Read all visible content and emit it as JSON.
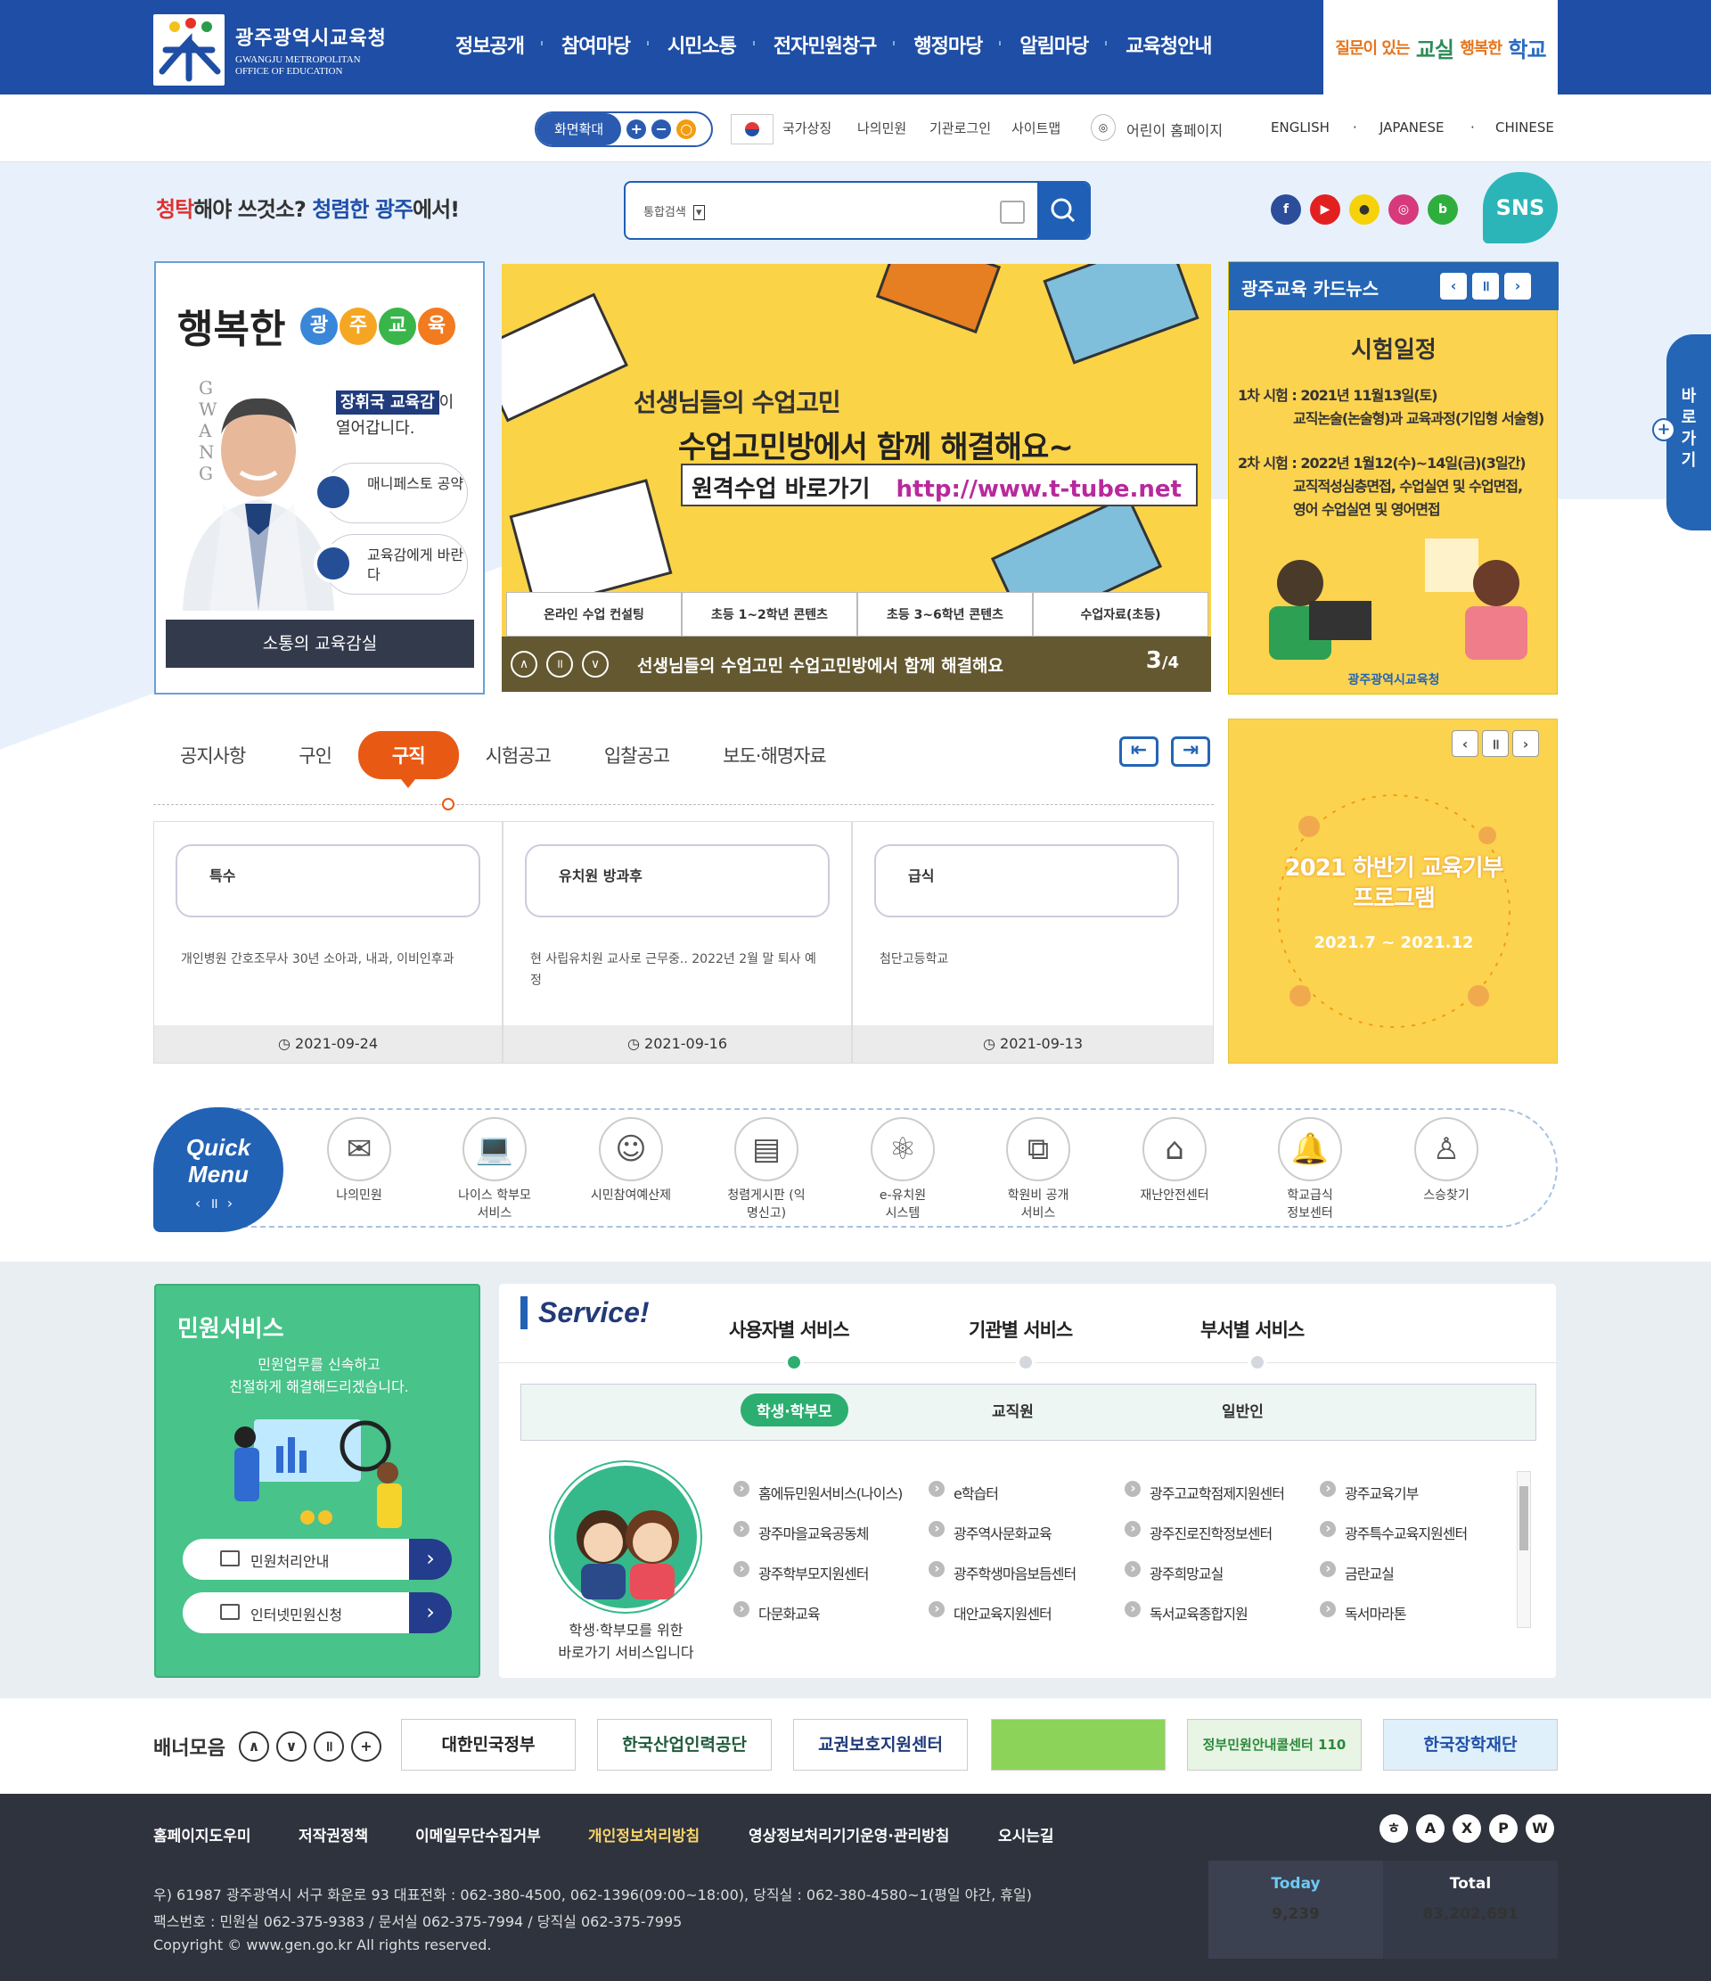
{
  "header": {
    "logo_ko": "광주광역시교육청",
    "logo_en_1": "GWANGJU METROPOLITAN",
    "logo_en_2": "OFFICE OF EDUCATION",
    "nav": [
      "정보공개",
      "참여마당",
      "시민소통",
      "전자민원창구",
      "행정마당",
      "알림마당",
      "교육청안내"
    ],
    "slogan_1": "질문이 있는",
    "slogan_2": "교실",
    "slogan_3": "행복한",
    "slogan_4": "학교"
  },
  "util": {
    "zoom_label": "화면확대",
    "links": [
      "국가상징",
      "나의민원",
      "기관로그인",
      "사이트맵"
    ],
    "kids": "어린이 홈페이지",
    "langs": [
      "ENGLISH",
      "JAPANESE",
      "CHINESE"
    ]
  },
  "campaign": {
    "p1": "청탁",
    "p2": "해야 쓰것소?",
    "p3": "청렴한 광주",
    "p4": "에서!"
  },
  "search": {
    "select": "통합검색"
  },
  "sns_label": "SNS",
  "superintendent": {
    "title_1": "행복한",
    "title_balls": [
      "광",
      "주",
      "교",
      "육"
    ],
    "vertical": "GWANG",
    "name": "장휘국 교육감",
    "name_suffix": "이",
    "name_line2": "열어갑니다.",
    "btn1": "매니페스토 공약",
    "btn2": "교육감에게 바란다",
    "bar": "소통의 교육감실"
  },
  "banner": {
    "h1": "선생님들의 수업고민",
    "h2": "수업고민방에서 함께 해결해요~",
    "link_label": "원격수업 바로가기",
    "link_url": "http://www.t-tube.net",
    "tabs": [
      "온라인 수업 컨설팅",
      "초등 1~2학년 콘텐츠",
      "초등 3~6학년 콘텐츠",
      "수업자료(초등)"
    ],
    "caption": "선생님들의 수업고민 수업고민방에서 함께 해결해요",
    "page": "3",
    "total": "/4"
  },
  "cardnews": {
    "title": "광주교육 카드뉴스",
    "headline": "시험일정",
    "l1": "1차 시험 : 2021년 11월13일(토)",
    "l2": "교직논술(논술형)과 교육과정(기입형 서술형)",
    "l3": "2차 시험 : 2022년 1월12(수)~14일(금)(3일간)",
    "l4": "교직적성심층면접, 수업실연 및 수업면접,",
    "l5": "영어 수업실연 및 영어면접",
    "footer": "광주광역시교육청"
  },
  "side": {
    "label": "바로가기"
  },
  "notice": {
    "tabs": [
      "공지사항",
      "구인",
      "구직",
      "시험공고",
      "입찰공고",
      "보도·해명자료"
    ],
    "active": "구직",
    "cards": [
      {
        "tag": "특수",
        "text": "개인병원 간호조무사 30년 소아과, 내과, 이비인후과",
        "date": "2021-09-24"
      },
      {
        "tag": "유치원 방과후",
        "text": "현 사립유치원 교사로 근무중.. 2022년 2월 말 퇴사 예정",
        "date": "2021-09-16"
      },
      {
        "tag": "급식",
        "text": "첨단고등학교",
        "date": "2021-09-13"
      }
    ]
  },
  "donation": {
    "title": "2021 하반기 교육기부 프로그램",
    "date": "2021.7 ~ 2021.12"
  },
  "quick": {
    "title_1": "Quick",
    "title_2": "Menu",
    "items": [
      {
        "label": "나의민원",
        "icon": "envelope-icon"
      },
      {
        "label": "나이스 학부모 서비스",
        "icon": "laptop-icon"
      },
      {
        "label": "시민참여예산제",
        "icon": "person-speech-icon"
      },
      {
        "label": "청렴게시판 (익명신고)",
        "icon": "notebook-icon"
      },
      {
        "label": "e-유치원 시스템",
        "icon": "atom-icon"
      },
      {
        "label": "학원비 공개 서비스",
        "icon": "puzzle-icon"
      },
      {
        "label": "재난안전센터",
        "icon": "house-icon"
      },
      {
        "label": "학교급식 정보센터",
        "icon": "bell-icon"
      },
      {
        "label": "스승찾기",
        "icon": "teacher-icon"
      }
    ]
  },
  "minwon": {
    "title": "민원서비스",
    "desc_1": "민원업무를 신속하고",
    "desc_2": "친절하게 해결해드리겠습니다.",
    "btn1": "민원처리안내",
    "btn2": "인터넷민원신청"
  },
  "service": {
    "logo": "Service!",
    "tabs": [
      "사용자별 서비스",
      "기관별 서비스",
      "부서별 서비스"
    ],
    "sub": [
      "학생·학부모",
      "교직원",
      "일반인"
    ],
    "desc_1": "학생·학부모를 위한",
    "desc_2": "바로가기 서비스입니다",
    "items": [
      "홈에듀민원서비스(나이스)",
      "e학습터",
      "광주고교학점제지원센터",
      "광주교육기부",
      "광주마을교육공동체",
      "광주역사문화교육",
      "광주진로진학정보센터",
      "광주특수교육지원센터",
      "광주학부모지원센터",
      "광주학생마음보듬센터",
      "광주희망교실",
      "금란교실",
      "다문화교육",
      "대안교육지원센터",
      "독서교육종합지원",
      "독서마라톤"
    ]
  },
  "banners": {
    "label": "배너모음",
    "items": [
      "대한민국정부",
      "한국산업인력공단",
      "교권보호지원센터",
      "",
      "정부민원안내콜센터 110",
      "한국장학재단"
    ]
  },
  "footer": {
    "links": [
      "홈페이지도우미",
      "저작권정책",
      "이메일무단수집거부",
      "개인정보처리방침",
      "영상정보처리기기운영·관리방침",
      "오시는길"
    ],
    "addr1": "우) 61987 광주광역시 서구 화운로 93   대표전화 : 062-380-4500, 062-1396(09:00~18:00), 당직실 : 062-380-4580~1(평일 야간, 휴일)",
    "addr2": "팩스번호 : 민원실 062-375-9383 / 문서실 062-375-7994 / 당직실 062-375-7995",
    "copy": "Copyright © www.gen.go.kr All rights reserved.",
    "today_label": "Today",
    "today": "9,239",
    "total_label": "Total",
    "total": "83,202,691"
  }
}
